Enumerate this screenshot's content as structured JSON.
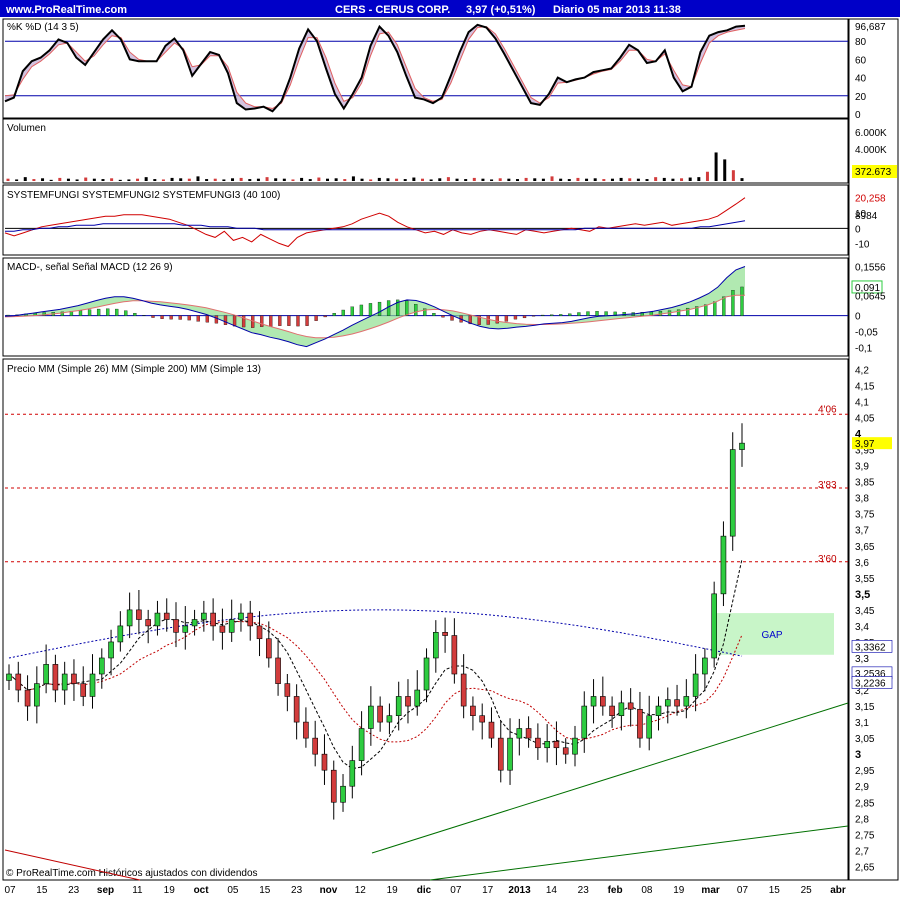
{
  "header": {
    "site": "www.ProRealTime.com",
    "instrument": "CERS - CERUS CORP.",
    "quote": "3,97 (+0,51%)",
    "period_info": "Diario  05 mar 2013 11:38"
  },
  "colors": {
    "header_bg": "#0000c8",
    "header_text": "#ffffff",
    "bull": "#2ecc40",
    "bear": "#d23c3c",
    "ma26": "#c00000",
    "ma200": "#0000aa",
    "ma13": "#000000",
    "trend": "#007000",
    "gap": "#c8f5c8",
    "level_line": "#d00000",
    "last_price_bg": "#ffff00"
  },
  "footer": "© ProRealTime.com  Históricos ajustados con dividendos",
  "x_axis_labels": [
    "07",
    "15",
    "23",
    "sep",
    "11",
    "19",
    "oct",
    "05",
    "15",
    "23",
    "nov",
    "12",
    "19",
    "dic",
    "07",
    "17",
    "2013",
    "14",
    "23",
    "feb",
    "08",
    "19",
    "mar",
    "07",
    "15",
    "25",
    "abr"
  ],
  "chart_data": [
    {
      "panel": "stochastic",
      "type": "line",
      "title": "%K %D (14 3 5)",
      "y_ticks": [
        "96,687",
        "80",
        "60",
        "40",
        "20",
        "0"
      ],
      "ylim": [
        0,
        100
      ],
      "reference_lines": [
        80,
        20
      ],
      "series": [
        {
          "name": "%K",
          "values": [
            14,
            18,
            47,
            58,
            62,
            70,
            82,
            78,
            62,
            54,
            68,
            82,
            92,
            82,
            60,
            58,
            58,
            58,
            75,
            83,
            70,
            42,
            55,
            68,
            65,
            45,
            12,
            5,
            6,
            8,
            3,
            14,
            40,
            72,
            93,
            80,
            50,
            22,
            6,
            22,
            40,
            75,
            96,
            86,
            68,
            42,
            18,
            16,
            12,
            18,
            42,
            68,
            90,
            98,
            95,
            83,
            66,
            48,
            30,
            12,
            10,
            22,
            40,
            35,
            38,
            40,
            46,
            48,
            50,
            62,
            76,
            70,
            56,
            58,
            70,
            40,
            25,
            30,
            68,
            86,
            90,
            92,
            96,
            97
          ],
          "last": 96.687
        },
        {
          "name": "%D",
          "values": [
            20,
            21,
            38,
            52,
            58,
            66,
            76,
            78,
            68,
            58,
            64,
            76,
            86,
            84,
            68,
            60,
            58,
            58,
            68,
            78,
            72,
            52,
            54,
            64,
            64,
            52,
            24,
            12,
            8,
            8,
            6,
            12,
            32,
            60,
            84,
            84,
            62,
            34,
            14,
            18,
            34,
            64,
            88,
            90,
            76,
            52,
            28,
            18,
            14,
            16,
            34,
            58,
            82,
            95,
            96,
            88,
            72,
            54,
            36,
            18,
            12,
            18,
            34,
            35,
            37,
            40,
            44,
            47,
            49,
            58,
            70,
            70,
            60,
            58,
            66,
            48,
            32,
            30,
            56,
            78,
            86,
            90,
            92,
            94
          ],
          "last": 94
        }
      ]
    },
    {
      "panel": "volume",
      "type": "bar",
      "title": "Volumen",
      "y_ticks": [
        "6.000K",
        "4.000K"
      ],
      "last_label": "372.673",
      "values": [
        300,
        200,
        500,
        250,
        350,
        150,
        400,
        300,
        200,
        450,
        300,
        250,
        350,
        150,
        200,
        300,
        500,
        250,
        200,
        400,
        350,
        300,
        600,
        250,
        300,
        200,
        350,
        400,
        250,
        300,
        500,
        350,
        300,
        200,
        400,
        250,
        450,
        300,
        350,
        250,
        600,
        300,
        200,
        400,
        350,
        300,
        250,
        450,
        300,
        200,
        350,
        500,
        300,
        250,
        400,
        300,
        200,
        350,
        300,
        250,
        400,
        350,
        300,
        600,
        300,
        250,
        400,
        300,
        350,
        250,
        300,
        400,
        350,
        300,
        250,
        500,
        400,
        300,
        350,
        450,
        500,
        1200,
        3700,
        2800,
        1400,
        372.673
      ]
    },
    {
      "panel": "systemfungi",
      "type": "line",
      "title": "SYSTEMFUNGI SYSTEMFUNGI2 SYSTEMFUNGI3 (40 100)",
      "y_ticks": [
        "20,258",
        "10",
        "8984",
        "0",
        "-10"
      ],
      "ylim": [
        -15,
        26
      ],
      "series": [
        {
          "name": "SYSTEMFUNGI2",
          "values": [
            -3,
            -5,
            -3,
            -1,
            1,
            2,
            3,
            4,
            5,
            6,
            7,
            8,
            8,
            9,
            9,
            9,
            8,
            7,
            6,
            4,
            2,
            -1,
            -4,
            -6,
            -2,
            -8,
            -6,
            -9,
            -4,
            -7,
            -10,
            -12,
            -6,
            -3,
            -2,
            -1,
            0,
            1,
            3,
            6,
            8,
            10,
            8,
            4,
            1,
            -1,
            -3,
            -2,
            -4,
            -1,
            -3,
            -4,
            -2,
            -1,
            -2,
            -3,
            -4,
            -1,
            -2,
            -3,
            -2,
            -1,
            0,
            -1,
            -2,
            1,
            0,
            1,
            2,
            3,
            2,
            3,
            4,
            2,
            3,
            4,
            5,
            6,
            8,
            12,
            16,
            20.258
          ],
          "last": 20.258
        },
        {
          "name": "SYSTEMFUNGI3",
          "values": [
            -2,
            -2,
            -1,
            -1,
            0,
            0,
            1,
            1,
            2,
            2,
            2,
            3,
            3,
            3,
            3,
            3,
            3,
            3,
            3,
            3,
            2,
            2,
            2,
            1,
            1,
            1,
            0,
            0,
            0,
            -1,
            -1,
            -1,
            -1,
            -1,
            -1,
            -1,
            -1,
            -1,
            -1,
            -1,
            -1,
            -1,
            -1,
            -1,
            -1,
            -1,
            -1,
            -1,
            -1,
            -1,
            -1,
            -1,
            -1,
            -1,
            -1,
            -1,
            -1,
            -1,
            -1,
            -1,
            -1,
            -1,
            -1,
            -1,
            -1,
            0,
            0,
            0,
            0,
            0,
            0,
            0,
            0,
            0,
            0,
            0,
            0,
            0,
            1,
            1,
            2,
            3,
            4,
            5
          ],
          "last": 8.8984
        }
      ]
    },
    {
      "panel": "macd",
      "type": "line",
      "title": "MACD-, señal Señal MACD (12 26 9)",
      "y_ticks": [
        "0,1556",
        "0,091",
        "0,0645",
        "0",
        "-0,05",
        "-0,1"
      ],
      "ylim": [
        -0.115,
        0.17
      ],
      "series": [
        {
          "name": "MACD",
          "values": [
            -0.002,
            0,
            0.004,
            0.008,
            0.012,
            0.016,
            0.02,
            0.026,
            0.032,
            0.04,
            0.048,
            0.055,
            0.06,
            0.06,
            0.055,
            0.048,
            0.04,
            0.034,
            0.03,
            0.026,
            0.02,
            0.012,
            0.004,
            -0.006,
            -0.018,
            -0.03,
            -0.042,
            -0.054,
            -0.06,
            -0.068,
            -0.074,
            -0.082,
            -0.092,
            -0.098,
            -0.086,
            -0.074,
            -0.06,
            -0.046,
            -0.03,
            -0.016,
            -0.002,
            0.012,
            0.028,
            0.042,
            0.05,
            0.048,
            0.04,
            0.028,
            0.014,
            0,
            -0.012,
            -0.024,
            -0.034,
            -0.04,
            -0.042,
            -0.04,
            -0.036,
            -0.034,
            -0.03,
            -0.026,
            -0.024,
            -0.022,
            -0.018,
            -0.012,
            -0.006,
            -0.002,
            0,
            0.002,
            0.004,
            0.006,
            0.01,
            0.014,
            0.02,
            0.026,
            0.034,
            0.044,
            0.056,
            0.07,
            0.09,
            0.12,
            0.145,
            0.1556
          ]
        },
        {
          "name": "Señal",
          "values": [
            -0.004,
            -0.003,
            -0.002,
            0,
            0.002,
            0.005,
            0.008,
            0.012,
            0.016,
            0.021,
            0.027,
            0.033,
            0.039,
            0.044,
            0.047,
            0.047,
            0.046,
            0.044,
            0.041,
            0.038,
            0.034,
            0.03,
            0.025,
            0.018,
            0.011,
            0.003,
            -0.006,
            -0.016,
            -0.025,
            -0.034,
            -0.042,
            -0.05,
            -0.059,
            -0.066,
            -0.07,
            -0.07,
            -0.068,
            -0.064,
            -0.058,
            -0.05,
            -0.041,
            -0.031,
            -0.02,
            -0.008,
            0.003,
            0.012,
            0.018,
            0.02,
            0.019,
            0.015,
            0.009,
            0.002,
            -0.005,
            -0.012,
            -0.018,
            -0.022,
            -0.025,
            -0.027,
            -0.028,
            -0.028,
            -0.027,
            -0.026,
            -0.024,
            -0.022,
            -0.019,
            -0.016,
            -0.013,
            -0.01,
            -0.007,
            -0.004,
            -0.001,
            0.002,
            0.006,
            0.01,
            0.015,
            0.02,
            0.027,
            0.035,
            0.046,
            0.06,
            0.0645,
            0.0645
          ]
        },
        {
          "name": "MACD-, señal",
          "values": [
            0.002,
            0.003,
            0.006,
            0.008,
            0.01,
            0.011,
            0.012,
            0.014,
            0.016,
            0.019,
            0.021,
            0.022,
            0.021,
            0.016,
            0.008,
            0.001,
            -0.006,
            -0.01,
            -0.011,
            -0.012,
            -0.014,
            -0.018,
            -0.021,
            -0.024,
            -0.029,
            -0.033,
            -0.036,
            -0.038,
            -0.035,
            -0.034,
            -0.032,
            -0.032,
            -0.033,
            -0.032,
            -0.016,
            -0.004,
            0.008,
            0.018,
            0.028,
            0.034,
            0.039,
            0.043,
            0.048,
            0.05,
            0.047,
            0.036,
            0.022,
            0.008,
            -0.005,
            -0.015,
            -0.021,
            -0.026,
            -0.029,
            -0.028,
            -0.024,
            -0.018,
            -0.011,
            -0.007,
            -0.002,
            0.002,
            0.003,
            0.004,
            0.006,
            0.01,
            0.013,
            0.014,
            0.013,
            0.012,
            0.011,
            0.01,
            0.011,
            0.012,
            0.014,
            0.016,
            0.019,
            0.024,
            0.029,
            0.035,
            0.044,
            0.06,
            0.0805,
            0.091
          ],
          "last": 0.091
        }
      ]
    },
    {
      "panel": "price",
      "type": "candlestick",
      "title": "Precio MM (Simple 26) MM (Simple 200) MM (Simple 13)",
      "legend": [
        "Precio",
        "MM (Simple 26)",
        "MM (Simple 200)",
        "MM (Simple 13)"
      ],
      "y_ticks": [
        "4,2",
        "4,15",
        "4,1",
        "4,05",
        "4",
        "3,95",
        "3,9",
        "3,85",
        "3,8",
        "3,75",
        "3,7",
        "3,65",
        "3,6",
        "3,55",
        "3,5",
        "3,45",
        "3,4",
        "3,35",
        "3,3",
        "3,25",
        "3,2",
        "3,15",
        "3,1",
        "3,05",
        "3",
        "2,95",
        "2,9",
        "2,85",
        "2,8",
        "2,75",
        "2,7",
        "2,65"
      ],
      "ylim": [
        2.62,
        4.22
      ],
      "close": [
        3.25,
        3.2,
        3.15,
        3.22,
        3.28,
        3.2,
        3.25,
        3.22,
        3.18,
        3.25,
        3.3,
        3.35,
        3.4,
        3.45,
        3.42,
        3.4,
        3.44,
        3.42,
        3.38,
        3.4,
        3.42,
        3.44,
        3.4,
        3.38,
        3.42,
        3.44,
        3.4,
        3.36,
        3.3,
        3.22,
        3.18,
        3.1,
        3.05,
        3,
        2.95,
        2.85,
        2.9,
        2.98,
        3.08,
        3.15,
        3.1,
        3.12,
        3.18,
        3.15,
        3.2,
        3.3,
        3.38,
        3.37,
        3.25,
        3.15,
        3.12,
        3.1,
        3.05,
        2.95,
        3.05,
        3.08,
        3.05,
        3.02,
        3.04,
        3.02,
        3,
        3.05,
        3.15,
        3.18,
        3.15,
        3.12,
        3.16,
        3.14,
        3.05,
        3.12,
        3.15,
        3.17,
        3.15,
        3.18,
        3.25,
        3.3,
        3.5,
        3.68,
        3.95,
        3.97
      ],
      "reference_levels": [
        {
          "label": "4'06",
          "value": 4.06
        },
        {
          "label": "3'83",
          "value": 3.83
        },
        {
          "label": "3'60",
          "value": 3.6
        }
      ],
      "gap_label": "GAP",
      "gap_range": [
        3.31,
        3.44
      ],
      "right_labels": [
        "3,97",
        "3,3362",
        "3,2536",
        "3,2236"
      ],
      "last_price": 3.97
    }
  ]
}
